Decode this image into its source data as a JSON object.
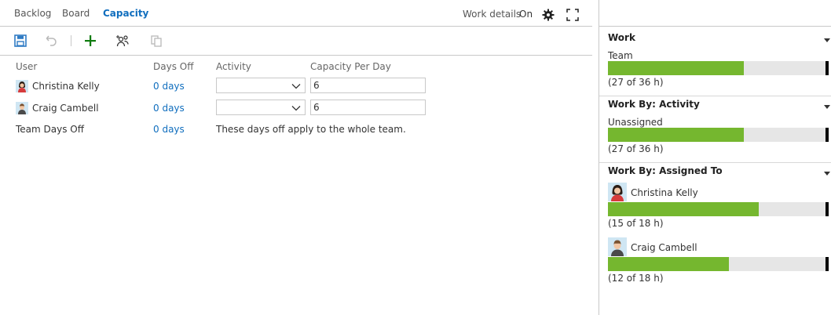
{
  "tabs": [
    {
      "label": "Backlog",
      "active": false
    },
    {
      "label": "Board",
      "active": false
    },
    {
      "label": "Capacity",
      "active": true
    }
  ],
  "header": {
    "work_details_label": "Work details",
    "work_details_state": "On"
  },
  "icons": {
    "save": "save-icon",
    "undo": "undo-icon",
    "add": "add-icon",
    "add_missing": "add-team-members-icon",
    "copy": "copy-icon",
    "settings": "gear-icon",
    "fullscreen": "fullscreen-icon"
  },
  "colors": {
    "accent": "#106ebe",
    "bar_fill": "#75b72f",
    "bar_track": "#e6e6e6",
    "add": "#107c10"
  },
  "grid": {
    "headers": [
      "User",
      "Days Off",
      "Activity",
      "Capacity Per Day"
    ],
    "rows": [
      {
        "user": "Christina Kelly",
        "days_off": "0 days",
        "activity": "",
        "capacity_per_day": "6"
      },
      {
        "user": "Craig Cambell",
        "days_off": "0 days",
        "activity": "",
        "capacity_per_day": "6"
      }
    ],
    "team_row": {
      "label": "Team Days Off",
      "days_off": "0 days",
      "note": "These days off apply to the whole team."
    }
  },
  "side": {
    "work": {
      "title": "Work",
      "label": "Team",
      "used": 27,
      "total": 36,
      "summary": "(27 of 36 h)"
    },
    "by_activity": {
      "title": "Work By: Activity",
      "label": "Unassigned",
      "used": 27,
      "total": 36,
      "summary": "(27 of 36 h)"
    },
    "by_assigned": {
      "title": "Work By: Assigned To",
      "people": [
        {
          "name": "Christina Kelly",
          "used": 15,
          "total": 18,
          "summary": "(15 of 18 h)"
        },
        {
          "name": "Craig Cambell",
          "used": 12,
          "total": 18,
          "summary": "(12 of 18 h)"
        }
      ]
    }
  }
}
